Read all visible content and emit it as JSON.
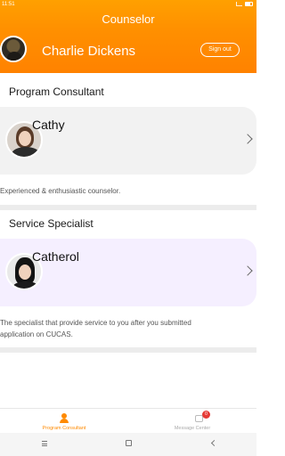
{
  "status_bar": {
    "time": "11:51"
  },
  "header": {
    "title": "Counselor",
    "user_name": "Charlie Dickens",
    "signout_label": "Sign out"
  },
  "sections": [
    {
      "title": "Program Consultant",
      "name": "Cathy",
      "description": "Experienced & enthusiastic counselor."
    },
    {
      "title": "Service Specialist",
      "name": "Catherol",
      "description_lines": [
        "The specialist that provide service to you after you submitted",
        "application on CUCAS."
      ]
    }
  ],
  "tabbar": {
    "tabs": [
      {
        "label": "Program Consultant",
        "icon": "person-icon",
        "active": true
      },
      {
        "label": "Message Center",
        "icon": "message-icon",
        "badge": "0"
      }
    ]
  },
  "colors": {
    "accent": "#ff8a00",
    "badge": "#e53935",
    "card_1": "#f2f2f2",
    "card_2": "#f5efff"
  }
}
